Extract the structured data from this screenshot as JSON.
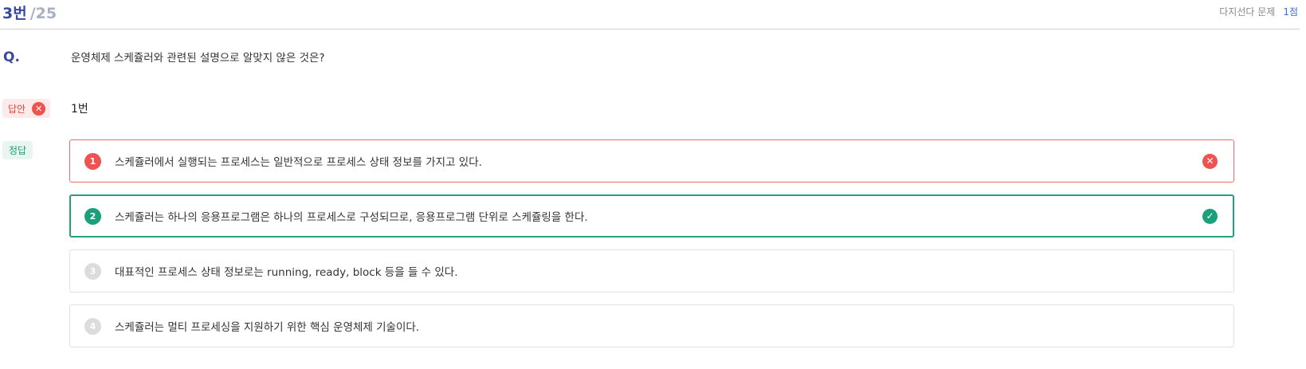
{
  "header": {
    "question_number": "3번",
    "question_total": "/25",
    "question_type": "다지선다 문제",
    "points": "1점"
  },
  "question": {
    "label": "Q.",
    "text": "운영체제 스케쥴러와 관련된 설명으로 알맞지 않은 것은?"
  },
  "user_answer": {
    "label": "답안",
    "value": "1번",
    "status_icon": "x-circle-icon"
  },
  "correct_answer": {
    "label": "정답"
  },
  "options": [
    {
      "number": "1",
      "text": "스케쥴러에서 실행되는 프로세스는 일반적으로 프로세스 상태 정보를 가지고 있다.",
      "state": "wrong",
      "icon": "x-circle-icon"
    },
    {
      "number": "2",
      "text": "스케쥴러는 하나의 응용프로그램은 하나의 프로세스로 구성되므로, 응용프로그램 단위로 스케쥴링을 한다.",
      "state": "correct",
      "icon": "check-circle-icon"
    },
    {
      "number": "3",
      "text": "대표적인 프로세스 상태 정보로는 running, ready, block 등을 들 수 있다.",
      "state": "neutral"
    },
    {
      "number": "4",
      "text": "스케쥴러는 멀티 프로세싱을 지원하기 위한 핵심 운영체제 기술이다.",
      "state": "neutral"
    }
  ],
  "colors": {
    "primary": "#3a4aa0",
    "wrong": "#ef5350",
    "correct": "#1aa07a",
    "points": "#3a6fd8"
  }
}
